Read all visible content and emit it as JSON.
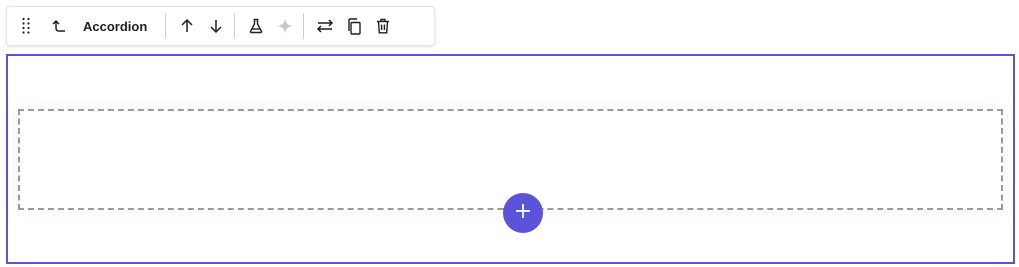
{
  "toolbar": {
    "block_name": "Accordion",
    "buttons": [
      {
        "name": "drag-handle",
        "icon": "drag-dots-icon",
        "enabled": true
      },
      {
        "name": "select-parent",
        "icon": "arrow-up-left-icon",
        "enabled": true
      },
      {
        "name": "move-up",
        "icon": "arrow-up-icon",
        "enabled": true
      },
      {
        "name": "move-down",
        "icon": "arrow-down-icon",
        "enabled": true
      },
      {
        "name": "flask",
        "icon": "flask-icon",
        "enabled": true
      },
      {
        "name": "ai-sparkle",
        "icon": "sparkle-icon",
        "enabled": false
      },
      {
        "name": "transform",
        "icon": "swap-arrows-icon",
        "enabled": true
      },
      {
        "name": "duplicate",
        "icon": "copy-icon",
        "enabled": true
      },
      {
        "name": "delete",
        "icon": "trash-icon",
        "enabled": true
      }
    ]
  },
  "block": {
    "selected": true,
    "accent_color": "#5b53d9",
    "add_button_icon": "plus-icon"
  }
}
